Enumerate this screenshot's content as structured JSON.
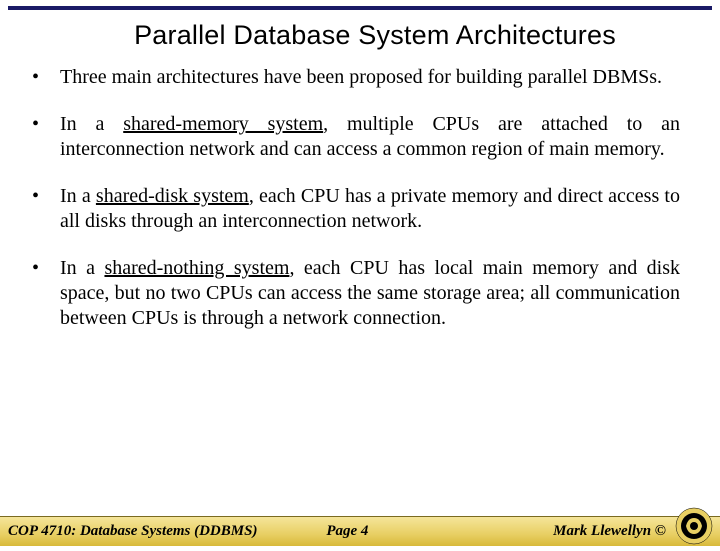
{
  "title": "Parallel Database System Architectures",
  "bullets": [
    {
      "pre": "Three main architectures have been proposed for building parallel DBMSs.",
      "term": "",
      "post": ""
    },
    {
      "pre": "In a ",
      "term": "shared-memory system",
      "post": ", multiple CPUs are attached to an interconnection network and can access a common region of main memory."
    },
    {
      "pre": "In a ",
      "term": "shared-disk system",
      "post": ", each CPU has a private memory and direct access to all disks through an interconnection network."
    },
    {
      "pre": "In a ",
      "term": "shared-nothing system",
      "post": ", each CPU has local main memory and disk space, but no two CPUs can access the same storage area; all communication between CPUs is through a network connection."
    }
  ],
  "footer": {
    "course": "COP 4710: Database Systems  (DDBMS)",
    "page": "Page 4",
    "author": "Mark Llewellyn ©"
  }
}
